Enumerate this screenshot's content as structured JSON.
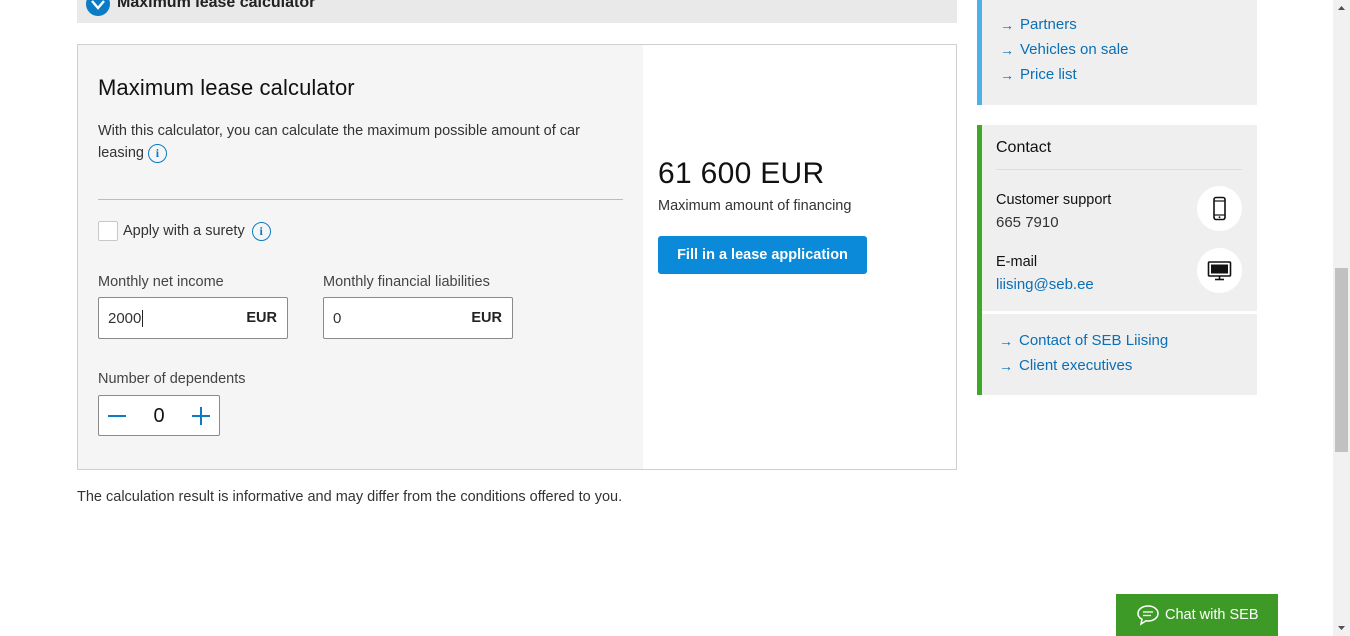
{
  "accordion": {
    "title": "Maximum lease calculator"
  },
  "calculator": {
    "title": "Maximum lease calculator",
    "description": "With this calculator, you can calculate the maximum possible amount of car leasing",
    "surety_label": "Apply with a surety",
    "surety_checked": false,
    "income": {
      "label": "Monthly net income",
      "value": "2000",
      "unit": "EUR"
    },
    "liabilities": {
      "label": "Monthly financial liabilities",
      "value": "0",
      "unit": "EUR"
    },
    "dependents": {
      "label": "Number of dependents",
      "value": "0"
    },
    "result": {
      "amount": "61 600 EUR",
      "label": "Maximum amount of financing"
    },
    "apply_button": "Fill in a lease application",
    "disclaimer": "The calculation result is informative and may differ from the conditions offered to you."
  },
  "sidebar": {
    "links": [
      {
        "label": "Partners"
      },
      {
        "label": "Vehicles on sale"
      },
      {
        "label": "Price list"
      }
    ],
    "contact": {
      "title": "Contact",
      "support_label": "Customer support",
      "support_phone": "665 7910",
      "email_label": "E-mail",
      "email": "liising@seb.ee",
      "links": [
        {
          "label": "Contact of SEB Liising"
        },
        {
          "label": "Client executives"
        }
      ]
    }
  },
  "chat": {
    "label": "Chat with SEB"
  },
  "colors": {
    "accent_blue": "#0a8ad9",
    "link_blue": "#0a6fb5",
    "contact_green": "#3fa825",
    "chat_green": "#3e9a26",
    "links_border_blue": "#4cb1e8"
  },
  "icons": {
    "accordion": "chevron-down-icon",
    "info": "info-icon",
    "minus": "minus-icon",
    "plus": "plus-icon",
    "arrow": "arrow-right-icon",
    "phone": "phone-icon",
    "monitor": "monitor-icon",
    "chat": "chat-bubble-icon"
  }
}
